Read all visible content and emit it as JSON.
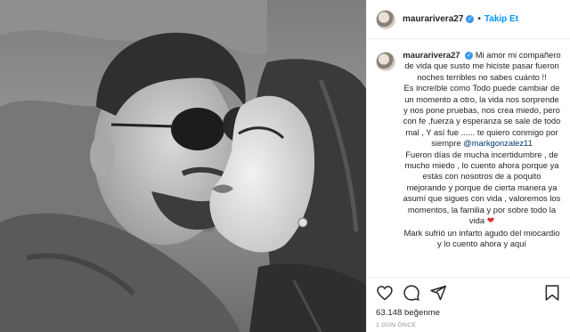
{
  "post": {
    "username": "maurarivera27",
    "verified_badge": "✓",
    "separator": "•",
    "follow_label": "Takip Et",
    "caption": {
      "username": "maurarivera27",
      "line1": "Mi amor mi compañero de vida que susto me hiciste pasar fueron noches terribles no sabes cuánto !!",
      "line2": "Es increíble como Todo puede cambiar de un momento a otro, la vida nos sorprende y nos pone pruebas, nos crea miedo, pero con fe ,fuerza y esperanza se sale de todo mal , Y así fue ...... te quiero conmigo por siempre",
      "mention": "@markgonzalez11",
      "line3": "Fueron días de mucha incertidumbre , de mucho miedo , lo cuento ahora porque ya estás con nosotros de a poquito mejorando y porque de cierta manera ya asumí que sigues con vida , valoremos los momentos, la familia y por sobre todo la vida",
      "heart": "❤",
      "line4": "Mark sufrió un infarto agudo del miocardio y lo cuento ahora y aquí"
    },
    "likes": "63.148 beğenme",
    "time": "1 GÜN ÖNCE"
  },
  "icons": {
    "like": "heart-icon",
    "comment": "comment-icon",
    "share": "share-icon",
    "save": "bookmark-icon"
  },
  "colors": {
    "link": "#0095f6",
    "mention": "#00376b",
    "verified": "#3897f0",
    "muted": "#8e8e8e"
  }
}
